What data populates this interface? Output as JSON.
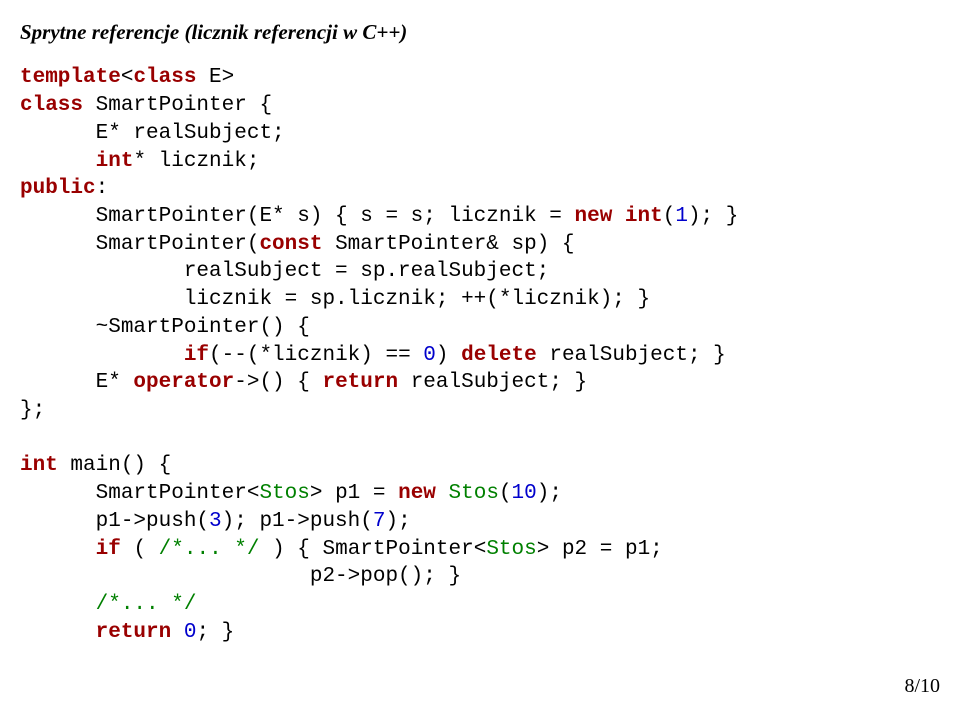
{
  "title": "Sprytne referencje (licznik referencji w C++)",
  "code": {
    "l01a": "template",
    "l01b": "<",
    "l01c": "class",
    "l01d": " E>",
    "l02a": "class",
    "l02b": " SmartPointer {",
    "l03a": "      E* realSubject;",
    "l04a": "      ",
    "l04b": "int",
    "l04c": "* licznik;",
    "l05a": "public",
    "l05b": ":",
    "l06a": "      SmartPointer(E* s) { s = s; licznik = ",
    "l06b": "new",
    "l06c": " ",
    "l06d": "int",
    "l06e": "(",
    "l06f": "1",
    "l06g": "); }",
    "l07a": "      SmartPointer(",
    "l07b": "const",
    "l07c": " SmartPointer& sp) {",
    "l08a": "             realSubject = sp.realSubject;",
    "l09a": "             licznik = sp.licznik; ++(*licznik); }",
    "l10a": "      ~SmartPointer() {",
    "l11a": "             ",
    "l11b": "if",
    "l11c": "(--(*licznik) == ",
    "l11d": "0",
    "l11e": ") ",
    "l11f": "delete",
    "l11g": " realSubject; }",
    "l12a": "      E* ",
    "l12b": "operator",
    "l12c": "->() { ",
    "l12d": "return",
    "l12e": " realSubject; }",
    "l13a": "};",
    "l14a": "int",
    "l14b": " main() {",
    "l15a": "      SmartPointer<",
    "l15b": "Stos",
    "l15c": "> p1 = ",
    "l15d": "new",
    "l15e": " ",
    "l15f": "Stos",
    "l15g": "(",
    "l15h": "10",
    "l15i": ");",
    "l16a": "      p1->push(",
    "l16b": "3",
    "l16c": "); p1->push(",
    "l16d": "7",
    "l16e": ");",
    "l17a": "      ",
    "l17b": "if",
    "l17c": " ( ",
    "l17d": "/*... */",
    "l17e": " ) { SmartPointer<",
    "l17f": "Stos",
    "l17g": "> p2 = p1;",
    "l18a": "                       p2->pop(); }",
    "l19a": "      ",
    "l19b": "/*... */",
    "l20a": "      ",
    "l20b": "return",
    "l20c": " ",
    "l20d": "0",
    "l20e": "; }"
  },
  "pagenum": "8/10"
}
